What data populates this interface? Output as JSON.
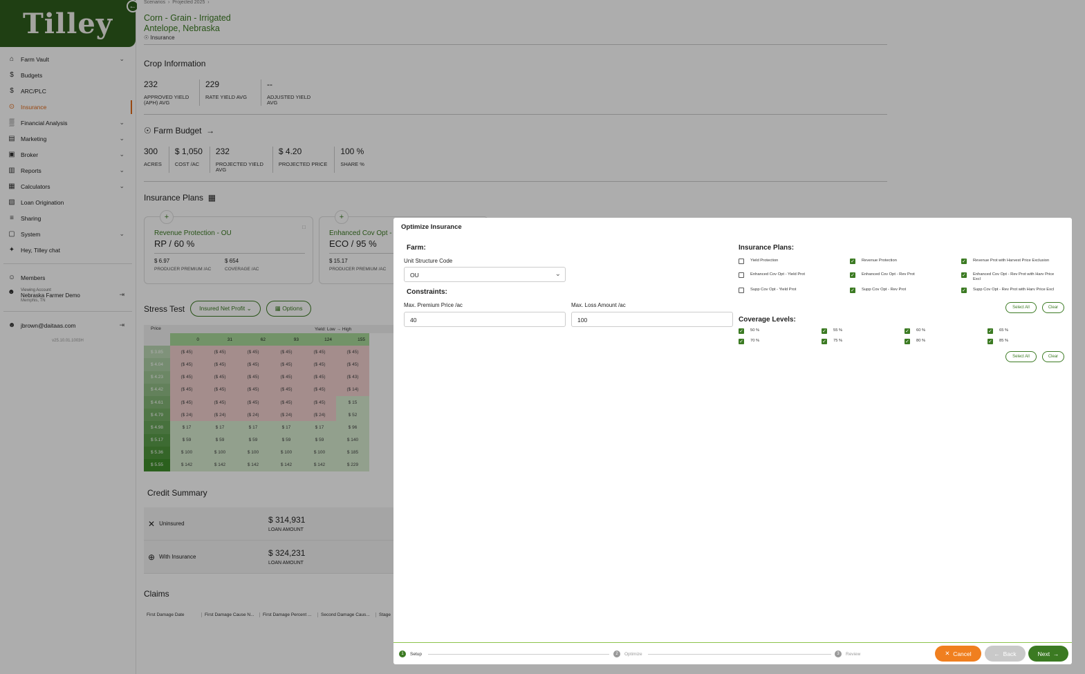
{
  "sidebar": {
    "logo": "Tilley",
    "items": [
      {
        "label": "Farm Vault",
        "icon": "vault-icon",
        "chev": true
      },
      {
        "label": "Budgets",
        "icon": "dollar-icon",
        "chev": false
      },
      {
        "label": "ARC/PLC",
        "icon": "dollar-icon",
        "chev": false
      },
      {
        "label": "Insurance",
        "icon": "insurance-icon",
        "chev": false,
        "active": true
      },
      {
        "label": "Financial Analysis",
        "icon": "chart-icon",
        "chev": true
      },
      {
        "label": "Marketing",
        "icon": "marketing-icon",
        "chev": true
      },
      {
        "label": "Broker",
        "icon": "broker-icon",
        "chev": true
      },
      {
        "label": "Reports",
        "icon": "reports-icon",
        "chev": true
      },
      {
        "label": "Calculators",
        "icon": "calculator-icon",
        "chev": true
      },
      {
        "label": "Loan Origination",
        "icon": "loan-icon",
        "chev": false
      },
      {
        "label": "Sharing",
        "icon": "sharing-icon",
        "chev": false
      },
      {
        "label": "System",
        "icon": "system-icon",
        "chev": true
      },
      {
        "label": "Hey, Tilley chat",
        "icon": "chat-icon",
        "chev": false
      }
    ],
    "members": "Members",
    "viewing_label": "Viewing Account",
    "account_name": "Nebraska Farmer Demo",
    "account_location": "Memphis, TN",
    "user_email": "jbrown@daitaas.com",
    "version": "v25.10.01.1003H"
  },
  "header": {
    "breadcrumb": [
      "Scenarios",
      "Projected 2025"
    ],
    "title_line1": "Corn - Grain - Irrigated",
    "title_line2": "Antelope, Nebraska",
    "section": "Insurance"
  },
  "crop_info": {
    "title": "Crop Information",
    "stats": [
      {
        "value": "232",
        "label": "APPROVED YIELD (APH) AVG"
      },
      {
        "value": "229",
        "label": "RATE YIELD AVG"
      },
      {
        "value": "--",
        "label": "ADJUSTED YIELD AVG"
      }
    ]
  },
  "farm_budget": {
    "title": "Farm Budget",
    "stats": [
      {
        "value": "300",
        "label": "ACRES"
      },
      {
        "value": "$ 1,050",
        "label": "COST /AC"
      },
      {
        "value": "232",
        "label": "PROJECTED YIELD AVG"
      },
      {
        "value": "$ 4.20",
        "label": "PROJECTED PRICE"
      },
      {
        "value": "100 %",
        "label": "SHARE %"
      }
    ]
  },
  "insurance_plans": {
    "title": "Insurance Plans",
    "cards": [
      {
        "name": "Revenue Protection - OU",
        "code": "RP / 60 %",
        "premium": "$ 6.97",
        "premium_label": "PRODUCER PREMIUM /AC",
        "coverage": "$ 654",
        "coverage_label": "COVERAGE /AC"
      },
      {
        "name": "Enhanced Cov Opt -",
        "code": "ECO / 95 %",
        "premium": "$ 15.17",
        "premium_label": "PRODUCER PREMIUM /AC",
        "coverage": "",
        "coverage_label": ""
      }
    ]
  },
  "stress_test": {
    "title": "Stress Test",
    "dropdown": "Insured Net Profit",
    "options": "Options",
    "price_header": "Price",
    "yield_header": "Yield: Low → High",
    "yields": [
      "0",
      "31",
      "62",
      "93",
      "124",
      "155"
    ],
    "rows": [
      {
        "price": "$ 3.85",
        "cells": [
          "($ 45)",
          "($ 45)",
          "($ 45)",
          "($ 45)",
          "($ 45)",
          "($ 45)"
        ]
      },
      {
        "price": "$ 4.04",
        "cells": [
          "($ 45)",
          "($ 45)",
          "($ 45)",
          "($ 45)",
          "($ 45)",
          "($ 45)"
        ]
      },
      {
        "price": "$ 4.23",
        "cells": [
          "($ 45)",
          "($ 45)",
          "($ 45)",
          "($ 45)",
          "($ 45)",
          "($ 43)"
        ]
      },
      {
        "price": "$ 4.42",
        "cells": [
          "($ 45)",
          "($ 45)",
          "($ 45)",
          "($ 45)",
          "($ 45)",
          "($ 14)"
        ]
      },
      {
        "price": "$ 4.61",
        "cells": [
          "($ 45)",
          "($ 45)",
          "($ 45)",
          "($ 45)",
          "($ 45)",
          "$ 15"
        ]
      },
      {
        "price": "$ 4.79",
        "cells": [
          "($ 24)",
          "($ 24)",
          "($ 24)",
          "($ 24)",
          "($ 24)",
          "$ 52"
        ]
      },
      {
        "price": "$ 4.98",
        "cells": [
          "$ 17",
          "$ 17",
          "$ 17",
          "$ 17",
          "$ 17",
          "$ 96"
        ]
      },
      {
        "price": "$ 5.17",
        "cells": [
          "$ 59",
          "$ 59",
          "$ 59",
          "$ 59",
          "$ 59",
          "$ 140"
        ]
      },
      {
        "price": "$ 5.36",
        "cells": [
          "$ 100",
          "$ 100",
          "$ 100",
          "$ 100",
          "$ 100",
          "$ 185"
        ]
      },
      {
        "price": "$ 5.55",
        "cells": [
          "$ 142",
          "$ 142",
          "$ 142",
          "$ 142",
          "$ 142",
          "$ 229"
        ]
      }
    ]
  },
  "credit": {
    "title": "Credit Summary",
    "rows": [
      {
        "label": "Uninsured",
        "amount": "$ 314,931",
        "amount_label": "LOAN AMOUNT"
      },
      {
        "label": "With Insurance",
        "amount": "$ 324,231",
        "amount_label": "LOAN AMOUNT"
      }
    ]
  },
  "claims": {
    "title": "Claims",
    "columns": [
      "First Damage Date",
      "First Damage Cause N...",
      "First Damage Percent ...",
      "Second Damage Caus...",
      "Stage"
    ]
  },
  "modal": {
    "title": "Optimize Insurance",
    "farm_heading": "Farm:",
    "unit_label": "Unit Structure Code",
    "unit_value": "OU",
    "constraints_heading": "Constraints:",
    "max_premium_label": "Max. Premium Price /ac",
    "max_premium_value": "40",
    "max_loss_label": "Max. Loss Amount /ac",
    "max_loss_value": "100",
    "plans_heading": "Insurance Plans:",
    "plans": [
      {
        "label": "Yield Protection",
        "checked": false
      },
      {
        "label": "Revenue Protection",
        "checked": true
      },
      {
        "label": "Revenue Prot with Harvest Price Exclusion",
        "checked": true
      },
      {
        "label": "Enhanced Cov Opt - Yield Prot",
        "checked": false
      },
      {
        "label": "Enhanced Cov Opt - Rev Prot",
        "checked": true
      },
      {
        "label": "Enhanced Cov Opt - Rev Prot with Harv Price Excl",
        "checked": true
      },
      {
        "label": "Supp Cov Opt - Yield Prot",
        "checked": false
      },
      {
        "label": "Supp Cov Opt - Rev Prot",
        "checked": true
      },
      {
        "label": "Supp Cov Opt - Rev Prot with Harv Price Excl",
        "checked": true
      }
    ],
    "select_all": "Select All",
    "clear": "Clear",
    "coverage_heading": "Coverage Levels:",
    "coverage": [
      {
        "label": "50 %",
        "checked": true
      },
      {
        "label": "55 %",
        "checked": true
      },
      {
        "label": "60 %",
        "checked": true
      },
      {
        "label": "65 %",
        "checked": true
      },
      {
        "label": "70 %",
        "checked": true
      },
      {
        "label": "75 %",
        "checked": true
      },
      {
        "label": "80 %",
        "checked": true
      },
      {
        "label": "85 %",
        "checked": true
      }
    ],
    "steps": [
      {
        "num": "1",
        "label": "Setup"
      },
      {
        "num": "2",
        "label": "Optimize"
      },
      {
        "num": "3",
        "label": "Review"
      }
    ],
    "cancel": "Cancel",
    "back": "Back",
    "next": "Next",
    "colors": {
      "green": "#3b7a22",
      "orange": "#f07f1f",
      "disabled": "#c9c9c9"
    }
  }
}
